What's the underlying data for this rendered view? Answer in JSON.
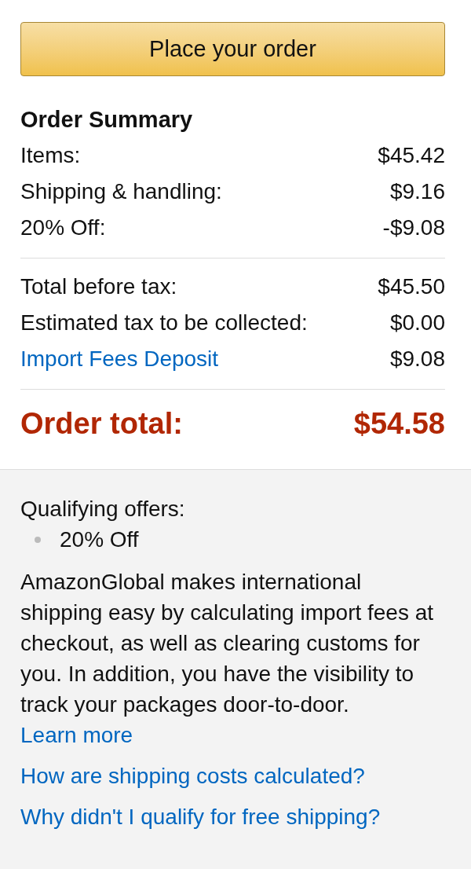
{
  "place_order_button": {
    "label": "Place your order"
  },
  "order_summary": {
    "title": "Order Summary",
    "groups": [
      {
        "rows": [
          {
            "kind": "text",
            "label": "Items:",
            "amount": "$45.42"
          },
          {
            "kind": "text",
            "label": "Shipping & handling:",
            "amount": "$9.16"
          },
          {
            "kind": "text",
            "label": "20% Off:",
            "amount": "-$9.08"
          }
        ]
      },
      {
        "rows": [
          {
            "kind": "text",
            "label": "Total before tax:",
            "amount": "$45.50"
          },
          {
            "kind": "text",
            "label": "Estimated tax to be collected:",
            "amount": "$0.00"
          },
          {
            "kind": "link",
            "label": "Import Fees Deposit",
            "amount": "$9.08"
          }
        ]
      }
    ],
    "total": {
      "label": "Order total:",
      "amount": "$54.58"
    }
  },
  "info": {
    "qualifying_offers_label": "Qualifying offers:",
    "offers": [
      "20% Off"
    ],
    "description": "AmazonGlobal makes international shipping easy by calculating import fees at checkout, as well as clearing customs for you. In addition, you have the visibility to track your packages door-to-door.",
    "learn_more_link": "Learn more",
    "links": [
      "How are shipping costs calculated?",
      "Why didn't I qualify for free shipping?"
    ]
  }
}
